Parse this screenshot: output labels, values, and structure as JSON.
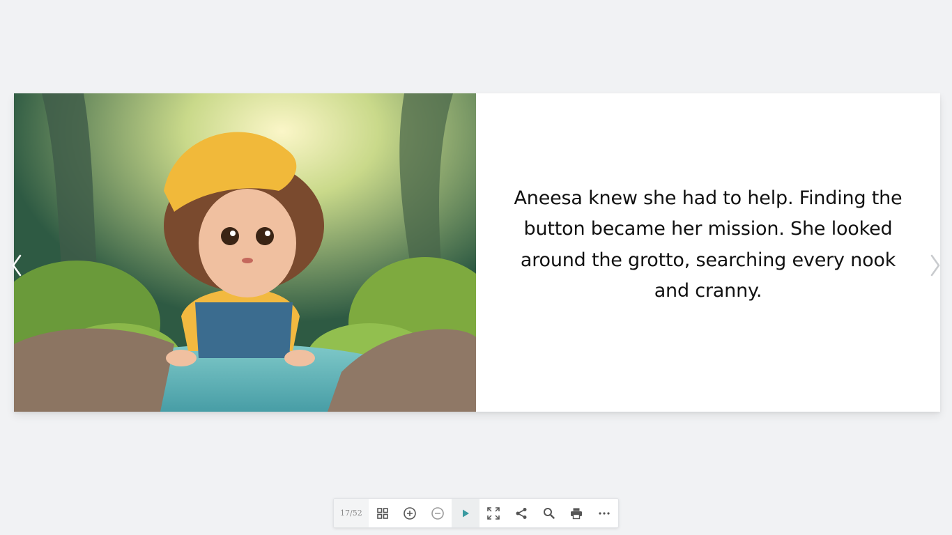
{
  "book": {
    "text": "Aneesa knew she had to help. Finding the button became her mission. She looked around the grotto, searching every nook and cranny."
  },
  "navigation": {
    "prev_icon": "chevron-left-icon",
    "next_icon": "chevron-right-icon"
  },
  "toolbar": {
    "page_counter": "17/52",
    "buttons": [
      {
        "icon": "grid-icon"
      },
      {
        "icon": "zoom-in-icon"
      },
      {
        "icon": "zoom-out-icon"
      },
      {
        "icon": "play-icon"
      },
      {
        "icon": "fullscreen-icon"
      },
      {
        "icon": "share-icon"
      },
      {
        "icon": "search-icon"
      },
      {
        "icon": "print-icon"
      },
      {
        "icon": "more-icon"
      }
    ]
  },
  "colors": {
    "background": "#f1f2f4",
    "accent": "#3a9aa0",
    "icon": "#555555"
  }
}
